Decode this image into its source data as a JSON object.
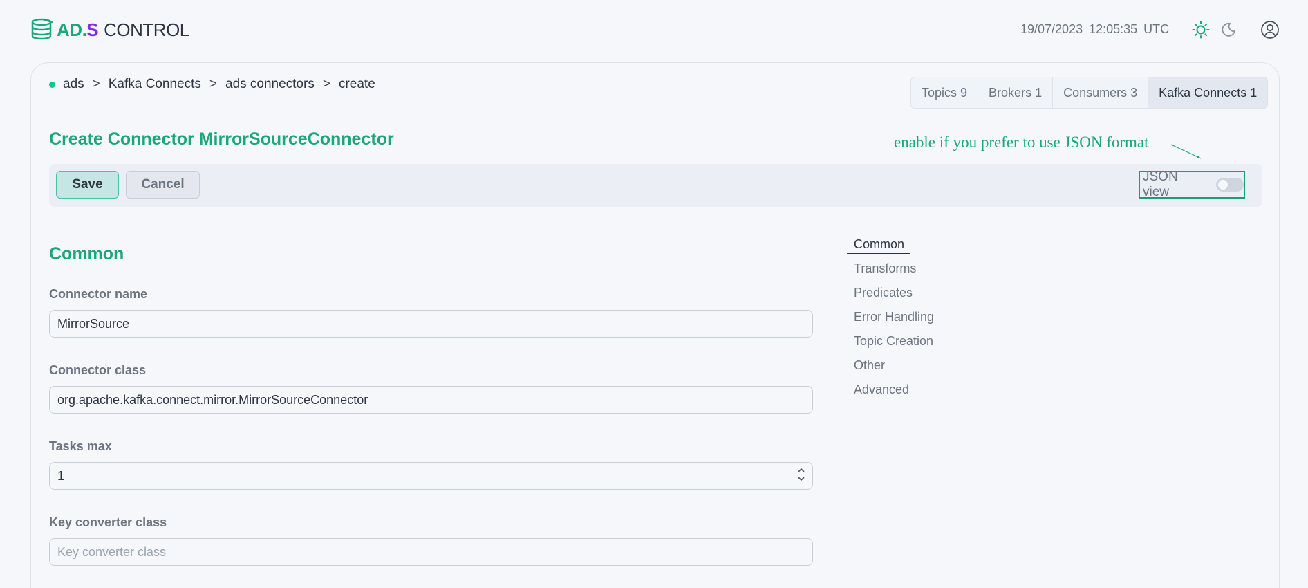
{
  "app": {
    "logo": {
      "ad": "AD",
      "dot": ".",
      "s": "S",
      "control": "CONTROL"
    },
    "datetime": "19/07/2023  12:05:35  UTC",
    "icons": {
      "theme_light": "sun-icon",
      "theme_dark": "moon-icon",
      "user": "user-icon"
    },
    "colors": {
      "accent": "#1aa87a",
      "logo_s": "#8a2be2",
      "status": "#19c294"
    }
  },
  "breadcrumb": [
    "ads",
    "Kafka Connects",
    "ads connectors",
    "create"
  ],
  "breadcrumb_separator": ">",
  "tabs": [
    {
      "label": "Topics 9",
      "active": false
    },
    {
      "label": "Brokers 1",
      "active": false
    },
    {
      "label": "Consumers 3",
      "active": false
    },
    {
      "label": "Kafka Connects 1",
      "active": true
    }
  ],
  "page": {
    "title": "Create Connector MirrorSourceConnector",
    "annotation": "enable if you prefer to use JSON format"
  },
  "toolbar": {
    "save_label": "Save",
    "cancel_label": "Cancel",
    "json_view_label": "JSON view",
    "json_view_enabled": false
  },
  "form": {
    "section_title": "Common",
    "connector_name": {
      "label": "Connector name",
      "value": "MirrorSource"
    },
    "connector_class": {
      "label": "Connector class",
      "value": "org.apache.kafka.connect.mirror.MirrorSourceConnector"
    },
    "tasks_max": {
      "label": "Tasks max",
      "value": "1"
    },
    "key_converter_class": {
      "label": "Key converter class",
      "value": "",
      "placeholder": "Key converter class"
    }
  },
  "side_nav": [
    "Common",
    "Transforms",
    "Predicates",
    "Error Handling",
    "Topic Creation",
    "Other",
    "Advanced"
  ],
  "side_nav_active": "Common"
}
